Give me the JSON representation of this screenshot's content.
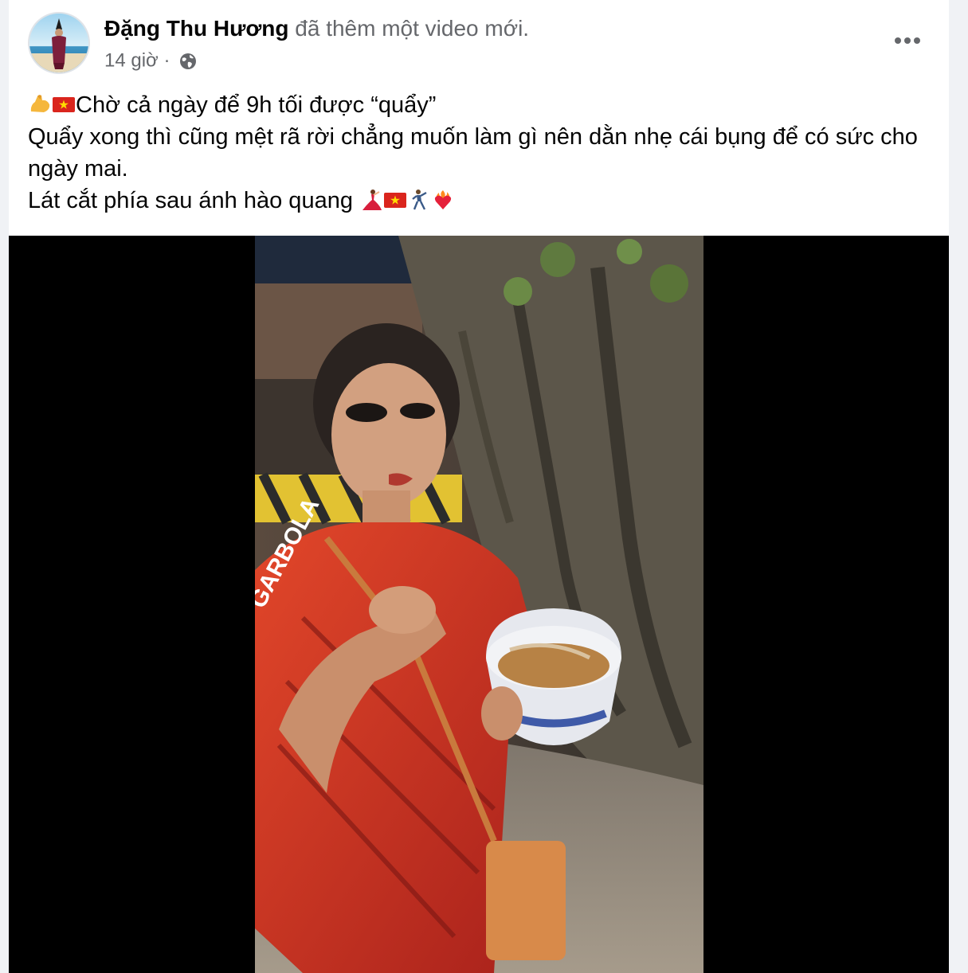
{
  "post": {
    "author_name": "Đặng Thu Hương",
    "action_text": "đã thêm một video mới.",
    "timestamp": "14 giờ",
    "separator": "·",
    "privacy_icon": "globe-icon",
    "more_icon": "more-horizontal-icon",
    "caption": {
      "line1": "Chờ cả ngày để 9h tối được “quẩy”",
      "line2": "Quẩy xong thì cũng mệt rã rời chẳng muốn làm gì nên dằn nhẹ cái bụng để có sức cho ngày mai.",
      "line3": "Lát cắt phía sau ánh hào quang",
      "emojis_line1": [
        "flexed-biceps-emoji",
        "vietnam-flag-emoji"
      ],
      "emojis_line3": [
        "dancer-emoji",
        "vietnam-flag-emoji",
        "person-dancing-emoji",
        "heart-on-fire-emoji"
      ]
    }
  },
  "video": {
    "description": "Vertical video of a woman in a red sports shirt eating from a paper bowl at night in front of a large tree"
  },
  "colors": {
    "page_bg": "#f0f2f5",
    "card_bg": "#ffffff",
    "primary_text": "#050505",
    "secondary_text": "#65676b",
    "video_bg": "#000000"
  }
}
